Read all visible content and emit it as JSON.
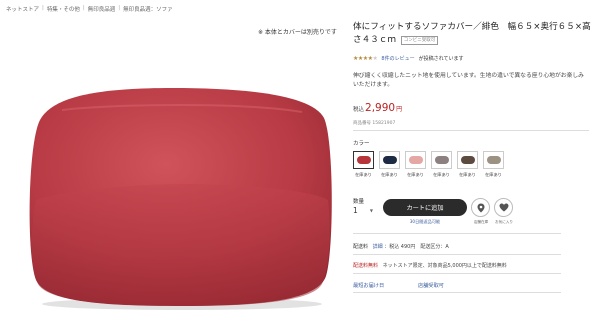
{
  "breadcrumb": [
    "ネットストア",
    "特集・その他",
    "無印良品週",
    "無印良品週：ソファ"
  ],
  "image_note": "※ 本体とカバーは別売りです",
  "product": {
    "title": "体にフィットするソファカバー／緋色　幅６５×奥行６５×高さ４３ｃｍ",
    "tag": "コンビニ受取可",
    "rating_stars": 4,
    "review_link": "8件のレビュー",
    "review_suffix": "が投稿されています",
    "description": "伸び縮くく収縮したニット地を使用しています。生地の違いで異なる座り心地がお楽しみいただけます。",
    "price_tax_label": "税込",
    "price": "2,990",
    "price_unit": "円",
    "item_number": "商品番号 15821907"
  },
  "colors": {
    "label": "カラー",
    "swatches": [
      {
        "name": "緋色",
        "color": "#b8343b",
        "stock": "在庫あり",
        "selected": true
      },
      {
        "name": "ネイビー",
        "color": "#1f2a44",
        "stock": "在庫あり",
        "selected": false
      },
      {
        "name": "ピンク",
        "color": "#e5a7a4",
        "stock": "在庫あり",
        "selected": false
      },
      {
        "name": "グレー",
        "color": "#8d8080",
        "stock": "在庫あり",
        "selected": false
      },
      {
        "name": "ブラウン",
        "color": "#5e4b40",
        "stock": "在庫あり",
        "selected": false
      },
      {
        "name": "ベージュ",
        "color": "#9c9283",
        "stock": "在庫あり",
        "selected": false
      }
    ]
  },
  "purchase": {
    "qty_label": "数量",
    "qty_value": "1",
    "cart_button": "カートに追加",
    "cart_note": "30日間返品可能",
    "store_stock_caption": "店舗在庫",
    "favorite_caption": "お気に入り"
  },
  "shipping": {
    "label": "配送料",
    "detail_link": "詳細",
    "text": "：税込 490円　配送区分：A"
  },
  "free_shipping": {
    "label": "配送料無料",
    "text": "ネットストア限定、対象商品5,000円以上で配送料無料"
  },
  "links": [
    "最短お届け日",
    "店舗受取可"
  ]
}
